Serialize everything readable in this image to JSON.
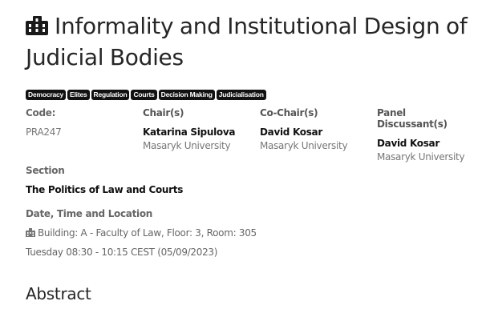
{
  "panel": {
    "icon": "building-icon",
    "title_line1": "Informality and Institutional Design of",
    "title_line2": "Judicial Bodies"
  },
  "tags": [
    "Democracy",
    "Elites",
    "Regulation",
    "Courts",
    "Decision Making",
    "Judicialisation"
  ],
  "details": {
    "code_label": "Code:",
    "code_value": "PRA247",
    "chair_label": "Chair(s)",
    "chair_name": "Katarina Sipulova",
    "chair_affiliation": "Masaryk University",
    "cochair_label": "Co-Chair(s)",
    "cochair_name": "David Kosar",
    "cochair_affiliation": "Masaryk University",
    "discussant_label": "Panel Discussant(s)",
    "discussant_name": "David Kosar",
    "discussant_affiliation": "Masaryk University"
  },
  "section": {
    "label": "Section",
    "value": "The Politics of Law and Courts"
  },
  "schedule": {
    "label": "Date, Time and Location",
    "location_icon": "building-icon",
    "location": "Building: A - Faculty of Law, Floor: 3, Room: 305",
    "datetime": "Tuesday 08:30 - 10:15 CEST (05/09/2023)"
  },
  "abstract_heading": "Abstract"
}
